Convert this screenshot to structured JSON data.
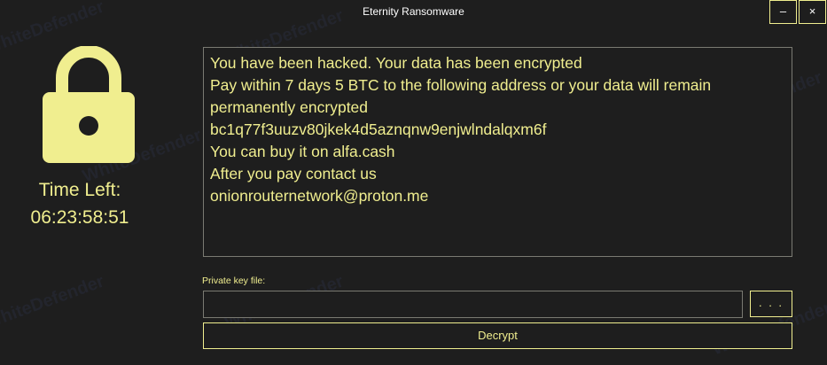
{
  "window": {
    "title": "Eternity Ransomware",
    "minimize_label": "–",
    "close_label": "×"
  },
  "timer": {
    "label": "Time Left:",
    "value": "06:23:58:51"
  },
  "message": {
    "lines": [
      "You have been hacked. Your data has been encrypted",
      "Pay within 7 days 5 BTC to the following address or your data will remain",
      "permanently encrypted",
      "bc1q77f3uuzv80jkek4d5aznqnw9enjwlndalqxm6f",
      "You can buy it on alfa.cash",
      "After you pay contact us",
      "onionrouternetwork@proton.me"
    ]
  },
  "private_key": {
    "label": "Private key file:",
    "value": "",
    "browse_label": ". . ."
  },
  "decrypt_label": "Decrypt",
  "watermark": "WhiteDefender",
  "colors": {
    "background": "#1e1e1e",
    "accent": "#f0ee8f",
    "border": "#7a7a72"
  },
  "icons": {
    "lock": "lock-icon"
  }
}
